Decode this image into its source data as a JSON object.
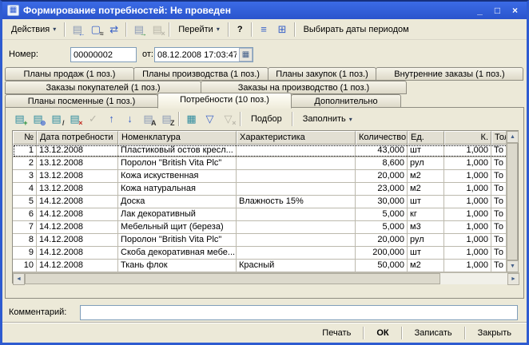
{
  "window": {
    "title": "Формирование потребностей: Не проведен",
    "controls": {
      "minimize": "_",
      "maximize": "□",
      "close": "×"
    }
  },
  "icons": {
    "window_glyph": "▦",
    "dropdown": "▾",
    "calendar": "▦",
    "scroll_up": "▲",
    "scroll_down": "▼",
    "scroll_left": "◄",
    "scroll_right": "►"
  },
  "colors": {
    "titlebar": "#2c58d0",
    "window_bg": "#ece9d8",
    "accent_blue": "#3a62c8",
    "table_grid": "#bcb9ad",
    "input_border": "#7f9db9"
  },
  "main_toolbar": {
    "actions_label": "Действия",
    "goto_label": "Перейти",
    "help_label": "?",
    "select_dates_label": "Выбирать даты периодом",
    "icons": {
      "reread": {
        "base": "▤",
        "badge": "←"
      },
      "movements": {
        "base": "▢",
        "badge": "≈"
      },
      "exchange": {
        "base": "⇄",
        "badge": ""
      },
      "post": {
        "base": "▤",
        "badge": "→"
      },
      "unpost": {
        "base": "▤",
        "badge": "×"
      },
      "list": {
        "base": "≡",
        "badge": ""
      },
      "form_settings": {
        "base": "⊞",
        "badge": ""
      }
    }
  },
  "fields": {
    "number_label": "Номер:",
    "number_value": "00000002",
    "from_label": "от:",
    "datetime_value": "08.12.2008 17:03:47"
  },
  "tabs": {
    "row1": [
      "Планы продаж (1 поз.)",
      "Планы производства (1 поз.)",
      "Планы закупок (1 поз.)",
      "Внутренние заказы (1 поз.)"
    ],
    "row2": [
      "Заказы покупателей (1 поз.)",
      "Заказы на производство (1 поз.)"
    ],
    "row3": [
      "Планы посменные (1 поз.)",
      "Потребности (10 поз.)",
      "Дополнительно"
    ]
  },
  "table_toolbar": {
    "pick_label": "Подбор",
    "fill_label": "Заполнить",
    "icons": {
      "add_row": {
        "base": "▤",
        "badge": "+"
      },
      "copy_row": {
        "base": "▤",
        "badge": "⊕"
      },
      "edit_row": {
        "base": "▤",
        "badge": "/"
      },
      "delete_row": {
        "base": "▤",
        "badge": "×"
      },
      "commit_row": {
        "base": "✓",
        "badge": ""
      },
      "move_up": {
        "base": "↑",
        "badge": ""
      },
      "move_down": {
        "base": "↓",
        "badge": ""
      },
      "sort_asc": {
        "base": "▤",
        "badge": "A"
      },
      "sort_desc": {
        "base": "▤",
        "badge": "Z"
      },
      "grid_settings": {
        "base": "▦",
        "badge": ""
      },
      "filter_sort": {
        "base": "▽",
        "badge": ""
      },
      "clear_filter": {
        "base": "▽",
        "badge": "×"
      }
    }
  },
  "table": {
    "columns": [
      "№",
      "Дата потребности",
      "Номенклатура",
      "Характеристика",
      "Количество",
      "Ед.",
      "К.",
      "Тол"
    ],
    "rows": [
      {
        "n": "1",
        "date": "13.12.2008",
        "name": "Пластиковый остов кресл...",
        "characteristic": "",
        "qty": "43,000",
        "unit": "шт",
        "k": "1,000",
        "rest": "То"
      },
      {
        "n": "2",
        "date": "13.12.2008",
        "name": "Поролон \"British Vita Plc\"",
        "characteristic": "",
        "qty": "8,600",
        "unit": "рул",
        "k": "1,000",
        "rest": "То"
      },
      {
        "n": "3",
        "date": "13.12.2008",
        "name": "Кожа искуственная",
        "characteristic": "",
        "qty": "20,000",
        "unit": "м2",
        "k": "1,000",
        "rest": "То"
      },
      {
        "n": "4",
        "date": "13.12.2008",
        "name": "Кожа натуральная",
        "characteristic": "",
        "qty": "23,000",
        "unit": "м2",
        "k": "1,000",
        "rest": "То"
      },
      {
        "n": "5",
        "date": "14.12.2008",
        "name": "Доска",
        "characteristic": "Влажность 15%",
        "qty": "30,000",
        "unit": "шт",
        "k": "1,000",
        "rest": "То"
      },
      {
        "n": "6",
        "date": "14.12.2008",
        "name": "Лак декоративный",
        "characteristic": "",
        "qty": "5,000",
        "unit": "кг",
        "k": "1,000",
        "rest": "То"
      },
      {
        "n": "7",
        "date": "14.12.2008",
        "name": "Мебельный щит (береза)",
        "characteristic": "",
        "qty": "5,000",
        "unit": "м3",
        "k": "1,000",
        "rest": "То"
      },
      {
        "n": "8",
        "date": "14.12.2008",
        "name": "Поролон \"British Vita Plc\"",
        "characteristic": "",
        "qty": "20,000",
        "unit": "рул",
        "k": "1,000",
        "rest": "То"
      },
      {
        "n": "9",
        "date": "14.12.2008",
        "name": "Скоба декоративная мебе...",
        "characteristic": "",
        "qty": "200,000",
        "unit": "шт",
        "k": "1,000",
        "rest": "То"
      },
      {
        "n": "10",
        "date": "14.12.2008",
        "name": "Ткань флок",
        "characteristic": "Красный",
        "qty": "50,000",
        "unit": "м2",
        "k": "1,000",
        "rest": "То"
      }
    ]
  },
  "comment": {
    "label": "Комментарий:",
    "value": ""
  },
  "footer": {
    "print": "Печать",
    "ok": "ОК",
    "write": "Записать",
    "close": "Закрыть"
  }
}
